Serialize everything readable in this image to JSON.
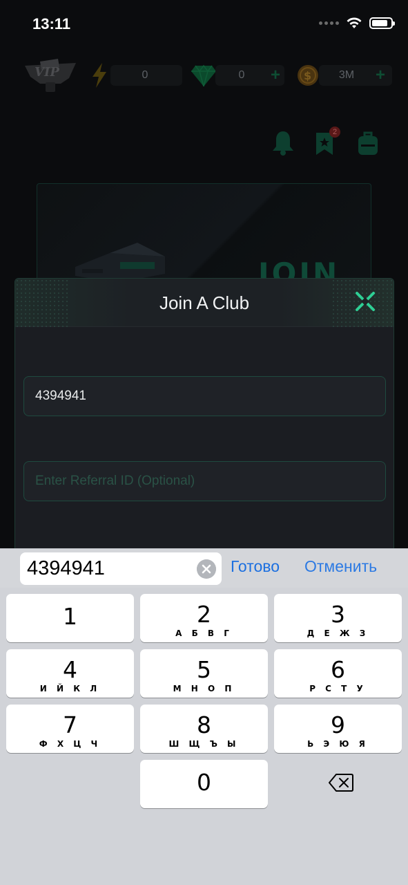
{
  "status_bar": {
    "time": "13:11"
  },
  "resources": {
    "vip_label": "VIP",
    "energy_value": "0",
    "gems_value": "0",
    "coins_value": "3M",
    "plus": "+"
  },
  "notifications": {
    "badge_count": "2"
  },
  "banner": {
    "text": "JOIN"
  },
  "modal": {
    "title": "Join A Club",
    "club_id_value": "4394941",
    "referral_placeholder": "Enter Referral ID (Optional)"
  },
  "accessory": {
    "input_value": "4394941",
    "done_label": "Готово",
    "cancel_label": "Отменить"
  },
  "keyboard": {
    "keys": [
      {
        "num": "1",
        "letters": ""
      },
      {
        "num": "2",
        "letters": "А Б В Г"
      },
      {
        "num": "3",
        "letters": "Д Е Ж З"
      },
      {
        "num": "4",
        "letters": "И Й К Л"
      },
      {
        "num": "5",
        "letters": "М Н О П"
      },
      {
        "num": "6",
        "letters": "Р С Т У"
      },
      {
        "num": "7",
        "letters": "Ф Х Ц Ч"
      },
      {
        "num": "8",
        "letters": "Ш Щ Ъ Ы"
      },
      {
        "num": "9",
        "letters": "Ь Э Ю Я"
      },
      {
        "num": "0",
        "letters": ""
      }
    ]
  },
  "colors": {
    "accent_green": "#2ecf95",
    "ios_blue": "#1b6fe0",
    "modal_bg": "#1b1d22",
    "backdrop": "#0b0c0e"
  },
  "icons": [
    "wifi-icon",
    "battery-icon",
    "vip-badge-icon",
    "lightning-icon",
    "gem-icon",
    "coin-icon",
    "bell-icon",
    "bookmark-star-icon",
    "backpack-icon",
    "close-icon",
    "clear-icon",
    "backspace-icon"
  ]
}
